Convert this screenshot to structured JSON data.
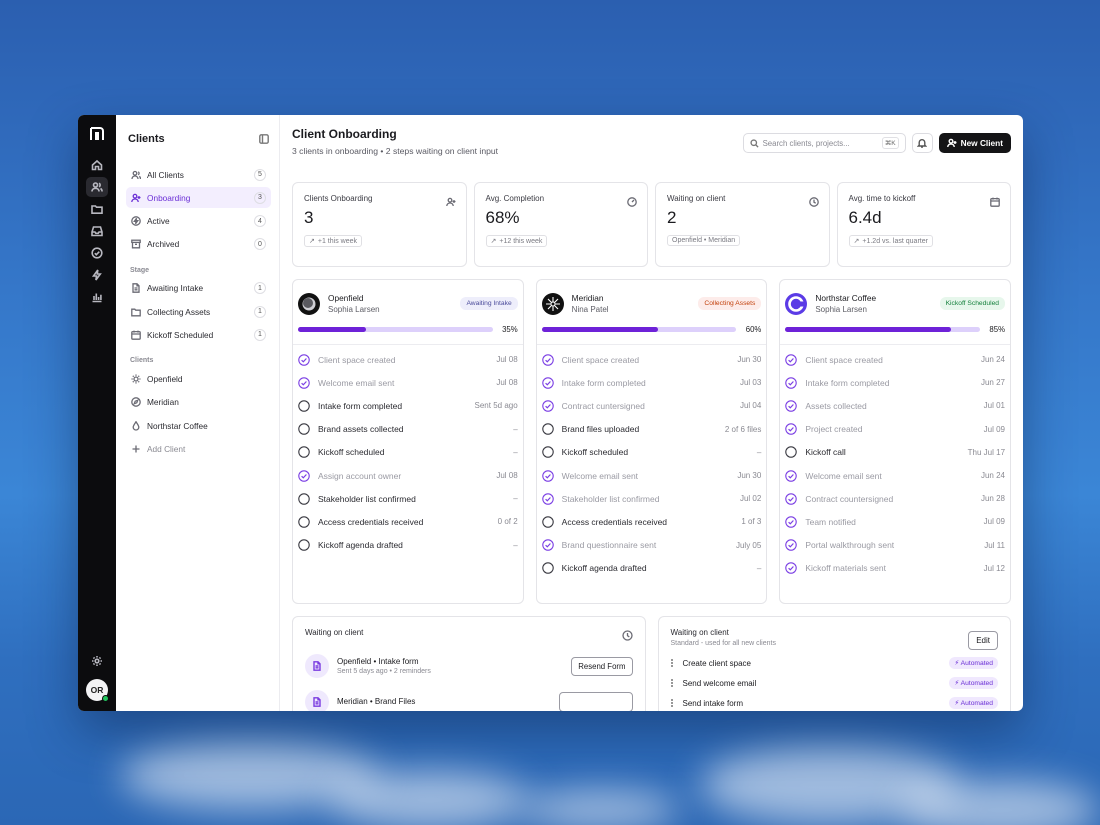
{
  "colors": {
    "accent": "#6e22d8",
    "accent_light": "#ddd0fb",
    "dark": "#141416"
  },
  "sidebar": {
    "title": "Clients",
    "nav": [
      {
        "label": "All Clients",
        "count": "5",
        "icon": "users-icon"
      },
      {
        "label": "Onboarding",
        "count": "3",
        "icon": "user-plus-icon",
        "active": true
      },
      {
        "label": "Active",
        "count": "4",
        "icon": "bolt-icon"
      },
      {
        "label": "Archived",
        "count": "0",
        "icon": "archive-icon"
      }
    ],
    "stage_heading": "Stage",
    "stages": [
      {
        "label": "Awaiting Intake",
        "count": "1",
        "icon": "file-icon"
      },
      {
        "label": "Collecting Assets",
        "count": "1",
        "icon": "folder-icon"
      },
      {
        "label": "Kickoff Scheduled",
        "count": "1",
        "icon": "calendar-icon"
      }
    ],
    "clients_heading": "Clients",
    "clients": [
      {
        "label": "Openfield",
        "icon": "sun-icon"
      },
      {
        "label": "Meridian",
        "icon": "compass-icon"
      },
      {
        "label": "Northstar Coffee",
        "icon": "drop-icon"
      }
    ],
    "add_client": "Add Client"
  },
  "user": {
    "initials": "OR"
  },
  "header": {
    "title": "Client Onboarding",
    "subtitle": "3 clients in onboarding • 2 steps waiting on client input",
    "search_placeholder": "Search clients, projects...",
    "search_shortcut": "⌘K",
    "new_client": "New Client"
  },
  "stats": [
    {
      "label": "Clients Onboarding",
      "value": "3",
      "chip": "+1 this week",
      "icon": "user-plus-icon"
    },
    {
      "label": "Avg. Completion",
      "value": "68%",
      "chip": "+12 this week",
      "icon": "gauge-icon"
    },
    {
      "label": "Waiting on client",
      "value": "2",
      "chip": "Openfield • Meridian",
      "icon": "clock-icon"
    },
    {
      "label": "Avg. time to kickoff",
      "value": "6.4d",
      "chip": "+1.2d vs. last quarter",
      "icon": "calendar-icon"
    }
  ],
  "clients": [
    {
      "name": "Openfield",
      "owner": "Sophia Larsen",
      "badge": "Awaiting Intake",
      "badge_bg": "#eeeefb",
      "badge_fg": "#4a4a9a",
      "progress": 35,
      "pct": "35%",
      "steps": [
        {
          "name": "Client space created",
          "date": "Jul 08",
          "done": true
        },
        {
          "name": "Welcome email sent",
          "date": "Jul 08",
          "done": true
        },
        {
          "name": "Intake form completed",
          "date": "Sent 5d ago",
          "done": false
        },
        {
          "name": "Brand assets collected",
          "date": "–",
          "done": false
        },
        {
          "name": "Kickoff scheduled",
          "date": "–",
          "done": false
        },
        {
          "name": "Assign account owner",
          "date": "Jul 08",
          "done": true
        },
        {
          "name": "Stakeholder list confirmed",
          "date": "–",
          "done": false
        },
        {
          "name": "Access credentials received",
          "date": "0 of 2",
          "done": false
        },
        {
          "name": "Kickoff agenda drafted",
          "date": "–",
          "done": false
        }
      ]
    },
    {
      "name": "Meridian",
      "owner": "Nina Patel",
      "badge": "Collecting Assets",
      "badge_bg": "#fdecea",
      "badge_fg": "#c2410c",
      "progress": 60,
      "pct": "60%",
      "steps": [
        {
          "name": "Client space created",
          "date": "Jun 30",
          "done": true
        },
        {
          "name": "Intake form completed",
          "date": "Jul 03",
          "done": true
        },
        {
          "name": "Contract cuntersigned",
          "date": "Jul 04",
          "done": true
        },
        {
          "name": "Brand files uploaded",
          "date": "2 of 6 files",
          "done": false
        },
        {
          "name": "Kickoff scheduled",
          "date": "–",
          "done": false
        },
        {
          "name": "Welcome email sent",
          "date": "Jun 30",
          "done": true
        },
        {
          "name": "Stakeholder list confirmed",
          "date": "Jul 02",
          "done": true
        },
        {
          "name": "Access credentials received",
          "date": "1 of 3",
          "done": false
        },
        {
          "name": "Brand questionnaire sent",
          "date": "July 05",
          "done": true
        },
        {
          "name": "Kickoff agenda drafted",
          "date": "–",
          "done": false
        }
      ]
    },
    {
      "name": "Northstar Coffee",
      "owner": "Sophia Larsen",
      "badge": "Kickoff Scheduled",
      "badge_bg": "#e7f7ec",
      "badge_fg": "#15803d",
      "progress": 85,
      "pct": "85%",
      "steps": [
        {
          "name": "Client space created",
          "date": "Jun 24",
          "done": true
        },
        {
          "name": "Intake form completed",
          "date": "Jun 27",
          "done": true
        },
        {
          "name": "Assets collected",
          "date": "Jul 01",
          "done": true
        },
        {
          "name": "Project created",
          "date": "Jul 09",
          "done": true
        },
        {
          "name": "Kickoff call",
          "date": "Thu Jul 17",
          "done": false
        },
        {
          "name": "Welcome email sent",
          "date": "Jun 24",
          "done": true
        },
        {
          "name": "Contract countersigned",
          "date": "Jun 28",
          "done": true
        },
        {
          "name": "Team notified",
          "date": "Jul 09",
          "done": true
        },
        {
          "name": "Portal walkthrough sent",
          "date": "Jul 11",
          "done": true
        },
        {
          "name": "Kickoff materials sent",
          "date": "Jul 12",
          "done": true
        }
      ]
    }
  ],
  "waiting_panel": {
    "title": "Waiting on client",
    "rows": [
      {
        "title": "Openfield • Intake form",
        "sub": "Sent 5 days ago • 2 reminders",
        "action": "Resend Form"
      },
      {
        "title": "Meridian • Brand Files",
        "sub": "",
        "action": ""
      }
    ]
  },
  "template_panel": {
    "title": "Waiting on client",
    "sub": "Standard - used for all new clients",
    "edit": "Edit",
    "rows": [
      {
        "label": "Create client space",
        "tag": "Automated"
      },
      {
        "label": "Send welcome email",
        "tag": "Automated"
      },
      {
        "label": "Send intake form",
        "tag": "Automated"
      }
    ]
  }
}
